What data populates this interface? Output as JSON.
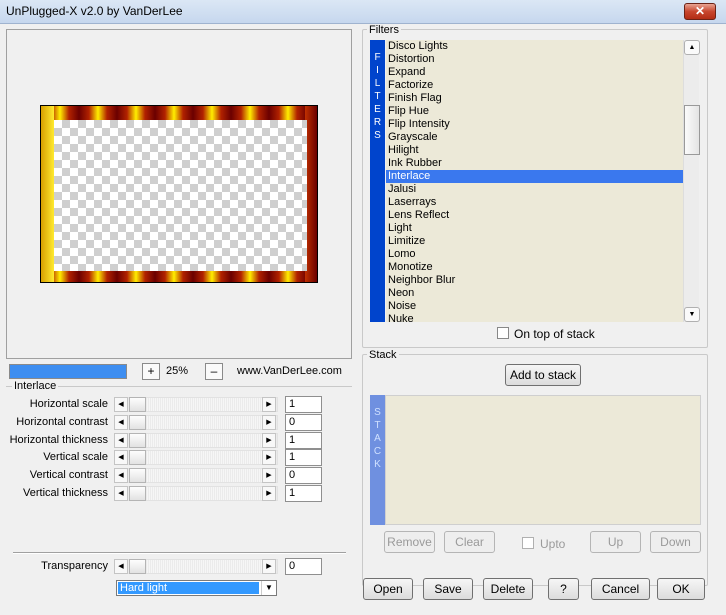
{
  "window": {
    "title": "UnPlugged-X v2.0 by VanDerLee",
    "close_glyph": "✕"
  },
  "preview": {
    "progress_fraction": 1.0,
    "zoom_plus": "+",
    "zoom_minus": "–",
    "zoom_value": "25%",
    "website": "www.VanDerLee.com"
  },
  "interlace": {
    "group_label": "Interlace",
    "params": [
      {
        "label": "Horizontal scale",
        "value": "1"
      },
      {
        "label": "Horizontal contrast",
        "value": "0"
      },
      {
        "label": "Horizontal thickness",
        "value": "1"
      },
      {
        "label": "Vertical scale",
        "value": "1"
      },
      {
        "label": "Vertical contrast",
        "value": "0"
      },
      {
        "label": "Vertical thickness",
        "value": "1"
      }
    ],
    "transparency": {
      "label": "Transparency",
      "value": "0"
    },
    "blend_mode": "Hard light"
  },
  "filters": {
    "group_label": "Filters",
    "strip_text": "FILTERS",
    "items": [
      "Disco Lights",
      "Distortion",
      "Expand",
      "Factorize",
      "Finish Flag",
      "Flip Hue",
      "Flip Intensity",
      "Grayscale",
      "Hilight",
      "Ink Rubber",
      "Interlace",
      "Jalusi",
      "Laserrays",
      "Lens Reflect",
      "Light",
      "Limitize",
      "Lomo",
      "Monotize",
      "Neighbor Blur",
      "Neon",
      "Noise",
      "Nuke"
    ],
    "selected_index": 10,
    "on_top_label": "On top of stack"
  },
  "stack": {
    "group_label": "Stack",
    "strip_text": "STACK",
    "add_label": "Add to stack",
    "remove_label": "Remove",
    "clear_label": "Clear",
    "upto_label": "Upto",
    "up_label": "Up",
    "down_label": "Down"
  },
  "footer": {
    "open": "Open",
    "save": "Save",
    "delete": "Delete",
    "help": "?",
    "cancel": "Cancel",
    "ok": "OK"
  }
}
